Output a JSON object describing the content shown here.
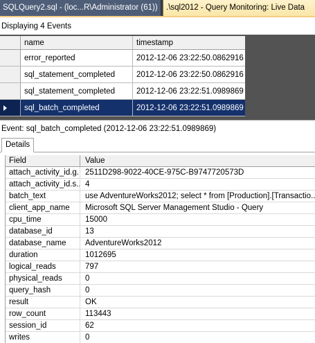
{
  "tabs": [
    {
      "label": "SQLQuery2.sql - (loc...R\\Administrator (61))",
      "active": false
    },
    {
      "label": ".\\sql2012 - Query Monitoring: Live Data",
      "active": true
    }
  ],
  "status": "Displaying 4 Events",
  "events": {
    "columns": [
      "name",
      "timestamp"
    ],
    "rows": [
      {
        "name": "error_reported",
        "timestamp": "2012-12-06 23:22:50.0862916"
      },
      {
        "name": "sql_statement_completed",
        "timestamp": "2012-12-06 23:22:50.0862916"
      },
      {
        "name": "sql_statement_completed",
        "timestamp": "2012-12-06 23:22:51.0989869"
      },
      {
        "name": "sql_batch_completed",
        "timestamp": "2012-12-06 23:22:51.0989869",
        "selected": true
      }
    ]
  },
  "event_caption": "Event: sql_batch_completed (2012-12-06 23:22:51.0989869)",
  "details": {
    "tab_label": "Details",
    "columns": [
      "Field",
      "Value"
    ],
    "rows": [
      {
        "field": "attach_activity_id.g...",
        "value": "2511D298-9022-40CE-975C-B9747720573D"
      },
      {
        "field": "attach_activity_id.s...",
        "value": "4"
      },
      {
        "field": "batch_text",
        "value": "use AdventureWorks2012;  select * from [Production].[Transactio..."
      },
      {
        "field": "client_app_name",
        "value": "Microsoft SQL Server Management Studio - Query"
      },
      {
        "field": "cpu_time",
        "value": "15000"
      },
      {
        "field": "database_id",
        "value": "13"
      },
      {
        "field": "database_name",
        "value": "AdventureWorks2012"
      },
      {
        "field": "duration",
        "value": "1012695"
      },
      {
        "field": "logical_reads",
        "value": "797"
      },
      {
        "field": "physical_reads",
        "value": "0"
      },
      {
        "field": "query_hash",
        "value": "0"
      },
      {
        "field": "result",
        "value": "OK"
      },
      {
        "field": "row_count",
        "value": "113443"
      },
      {
        "field": "session_id",
        "value": "62"
      },
      {
        "field": "writes",
        "value": "0"
      }
    ]
  },
  "colors": {
    "selected_row": "#14316c",
    "tabstrip": "#36404f",
    "active_tab": "#f9e6a8",
    "grid_background": "#535353"
  }
}
